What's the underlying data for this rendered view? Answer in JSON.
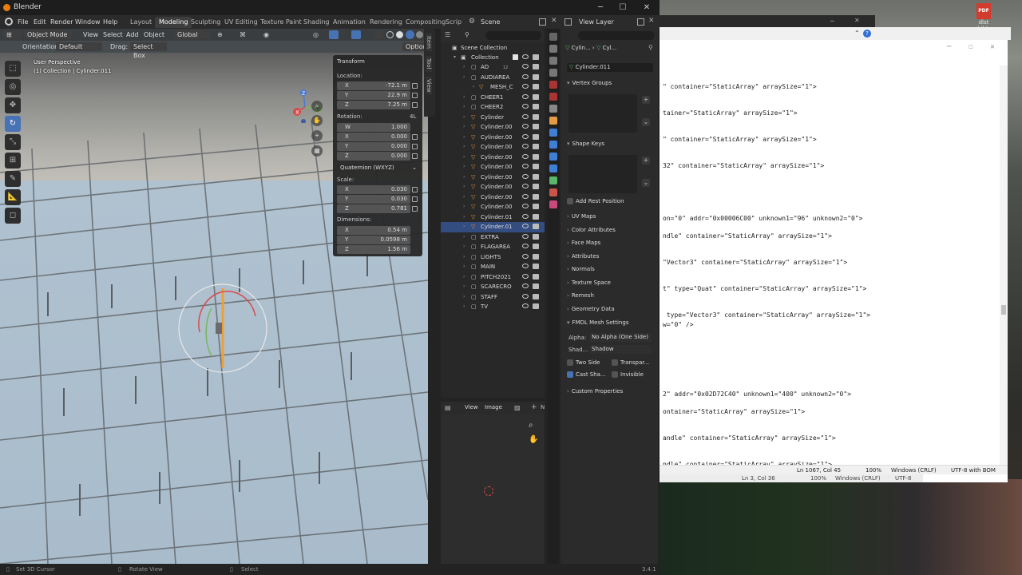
{
  "window": {
    "title": "Blender",
    "min": "─",
    "max": "☐",
    "close": "✕"
  },
  "menu": [
    "File",
    "Edit",
    "Render",
    "Window",
    "Help"
  ],
  "workspaces": [
    "Layout",
    "Modeling",
    "Sculpting",
    "UV Editing",
    "Texture Paint",
    "Shading",
    "Animation",
    "Rendering",
    "Compositing",
    "Scrip"
  ],
  "scene_name": "Scene",
  "view_layer": "View Layer",
  "viewport": {
    "mode": "Object Mode",
    "menus": [
      "View",
      "Select",
      "Add",
      "Object"
    ],
    "orientation_global": "Global",
    "orientation_label": "Orientation:",
    "orientation_value": "Default",
    "drag_label": "Drag:",
    "drag_value": "Select Box",
    "options": "Options",
    "persp_line1": "User Perspective",
    "persp_line2": "(1) Collection | Cylinder.011",
    "gizmo_x": "X",
    "gizmo_y": "Y",
    "gizmo_z": "Z"
  },
  "transform": {
    "title": "Transform",
    "location_label": "Location:",
    "location": [
      {
        "k": "X",
        "v": "-72.1 m"
      },
      {
        "k": "Y",
        "v": "22.9 m"
      },
      {
        "k": "Z",
        "v": "7.25 m"
      }
    ],
    "rotation_label": "Rotation:",
    "rotation_mode_short": "4L",
    "rotation": [
      {
        "k": "W",
        "v": "1.000"
      },
      {
        "k": "X",
        "v": "0.000"
      },
      {
        "k": "Y",
        "v": "0.000"
      },
      {
        "k": "Z",
        "v": "0.000"
      }
    ],
    "rotation_mode": "Quaternion (WXYZ)",
    "scale_label": "Scale:",
    "scale": [
      {
        "k": "X",
        "v": "0.030"
      },
      {
        "k": "Y",
        "v": "0.030"
      },
      {
        "k": "Z",
        "v": "0.781"
      }
    ],
    "dimensions_label": "Dimensions:",
    "dimensions": [
      {
        "k": "X",
        "v": "0.54 m"
      },
      {
        "k": "Y",
        "v": "0.0598 m"
      },
      {
        "k": "Z",
        "v": "1.56 m"
      }
    ]
  },
  "side_tabs": [
    "Item",
    "Tool",
    "View"
  ],
  "outliner": {
    "scene_collection": "Scene Collection",
    "collection": "Collection",
    "items": [
      "AD",
      "AUDIAREA",
      "MESH_C",
      "CHEER1",
      "CHEER2",
      "Cylinder",
      "Cylinder.00",
      "Cylinder.00",
      "Cylinder.00",
      "Cylinder.00",
      "Cylinder.00",
      "Cylinder.00",
      "Cylinder.00",
      "Cylinder.00",
      "Cylinder.00",
      "Cylinder.01",
      "Cylinder.01",
      "EXTRA",
      "FLAGAREA",
      "LIGHTS",
      "MAIN",
      "PITCH2021",
      "SCARECRO",
      "STAFF",
      "TV"
    ],
    "ad_count": "12",
    "selected_index": 16
  },
  "image_editor": {
    "menus": [
      "View",
      "Image"
    ],
    "new": "N"
  },
  "properties": {
    "breadcrumb_a": "Cylin...",
    "breadcrumb_b": "Cyl...",
    "object_name": "Cylinder.011",
    "vertex_groups": "Vertex Groups",
    "shape_keys": "Shape Keys",
    "add_rest_position": "Add Rest Position",
    "sections": [
      "UV Maps",
      "Color Attributes",
      "Face Maps",
      "Attributes",
      "Normals",
      "Texture Space",
      "Remesh",
      "Geometry Data"
    ],
    "fmdl": "FMDL Mesh Settings",
    "alpha_label": "Alpha:",
    "alpha_value": "No Alpha (One Side)",
    "shadow_label": "Shad...",
    "shadow_value": "Shadow",
    "two_side": "Two Side",
    "transparent": "Transpar...",
    "cast_shadow": "Cast Sha...",
    "invisible": "Invisible",
    "custom_properties": "Custom Properties"
  },
  "status": {
    "left": "Set 3D Cursor",
    "mid": "Rotate View",
    "right": "Select",
    "version": "3.4.1"
  },
  "notepad": {
    "lines": [
      "\" container=\"StaticArray\" arraySize=\"1\">",
      "tainer=\"StaticArray\" arraySize=\"1\">",
      "\" container=\"StaticArray\" arraySize=\"1\">",
      "32\" container=\"StaticArray\" arraySize=\"1\">",
      "on=\"0\" addr=\"0x00006C00\" unknown1=\"96\" unknown2=\"0\">",
      "ndle\" container=\"StaticArray\" arraySize=\"1\">",
      "\"Vector3\" container=\"StaticArray\" arraySize=\"1\">",
      "t\" type=\"Quat\" container=\"StaticArray\" arraySize=\"1\">",
      " type=\"Vector3\" container=\"StaticArray\" arraySize=\"1\">",
      "w=\"0\" />",
      "2\" addr=\"0x02D72C40\" unknown1=\"400\" unknown2=\"0\">",
      "ontainer=\"StaticArray\" arraySize=\"1\">",
      "andle\" container=\"StaticArray\" arraySize=\"1\">",
      "ndle\" container=\"StaticArray\" arraySize=\"1\">"
    ],
    "status_pos": "Ln 1067, Col 45",
    "status_zoom": "100%",
    "status_eol": "Windows (CRLF)",
    "status_enc": "UTF-8 with BOM",
    "status2_pos": "Ln 3, Col 36",
    "status2_zoom": "100%",
    "status2_eol": "Windows (CRLF)",
    "status2_enc": "UTF-8"
  },
  "desktop": {
    "pdf_label": "PDF",
    "pdf_name": "dlst child..."
  },
  "colors": {
    "accent": "#4772b3",
    "selected_row": "#334d80",
    "object_icon": "#e59b41"
  }
}
